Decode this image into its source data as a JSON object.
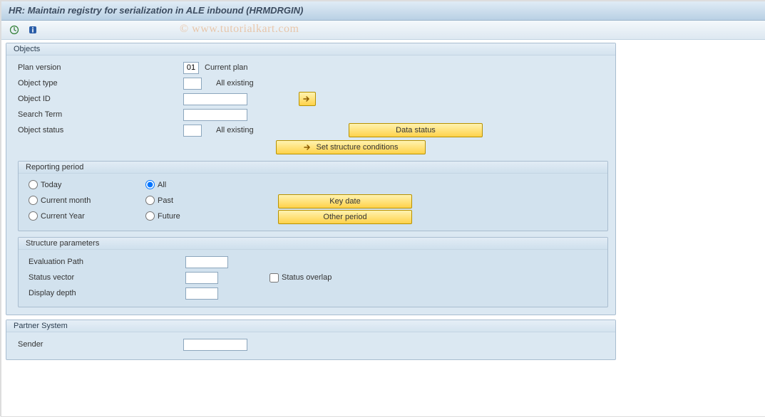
{
  "title": "HR: Maintain registry for serialization in ALE inbound (HRMDRGIN)",
  "watermark": "© www.tutorialkart.com",
  "toolbar": {
    "execute_title": "Execute",
    "info_title": "Information"
  },
  "objects": {
    "title": "Objects",
    "plan_version_label": "Plan version",
    "plan_version_value": "01",
    "plan_version_text": "Current plan",
    "object_type_label": "Object type",
    "object_type_value": "",
    "object_type_text": "All existing",
    "object_id_label": "Object ID",
    "object_id_value": "",
    "search_term_label": "Search Term",
    "search_term_value": "",
    "object_status_label": "Object status",
    "object_status_value": "",
    "object_status_text": "All existing",
    "multiple_selection_title": "Multiple selection",
    "data_status_btn": "Data status",
    "set_structure_btn": "Set structure conditions"
  },
  "reporting": {
    "title": "Reporting period",
    "today": "Today",
    "all": "All",
    "current_month": "Current month",
    "past": "Past",
    "current_year": "Current Year",
    "future": "Future",
    "selected": "All",
    "key_date_btn": "Key date",
    "other_period_btn": "Other period"
  },
  "structure": {
    "title": "Structure parameters",
    "evaluation_path_label": "Evaluation Path",
    "evaluation_path_value": "",
    "status_vector_label": "Status vector",
    "status_vector_value": "",
    "status_overlap_label": "Status overlap",
    "status_overlap_checked": false,
    "display_depth_label": "Display depth",
    "display_depth_value": ""
  },
  "partner": {
    "title": "Partner System",
    "sender_label": "Sender",
    "sender_value": ""
  }
}
